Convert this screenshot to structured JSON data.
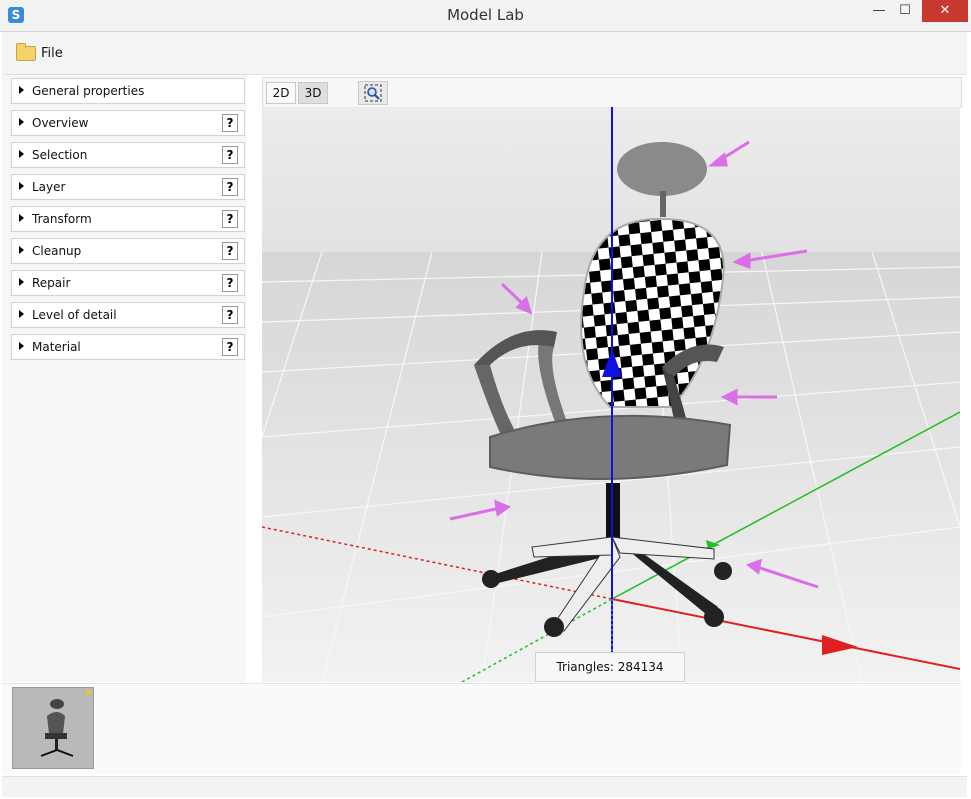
{
  "window": {
    "title": "Model Lab",
    "minimize": "—",
    "maximize": "☐",
    "close": "✕"
  },
  "menu": {
    "file_label": "File"
  },
  "panels": [
    {
      "label": "General properties",
      "help": false
    },
    {
      "label": "Overview",
      "help": true
    },
    {
      "label": "Selection",
      "help": true
    },
    {
      "label": "Layer",
      "help": true
    },
    {
      "label": "Transform",
      "help": true
    },
    {
      "label": "Cleanup",
      "help": true
    },
    {
      "label": "Repair",
      "help": true
    },
    {
      "label": "Level of detail",
      "help": true
    },
    {
      "label": "Material",
      "help": true
    }
  ],
  "help_glyph": "?",
  "toolbar": {
    "btn_2d": "2D",
    "btn_3d": "3D",
    "active_mode": "3D"
  },
  "viewport": {
    "triangles_label": "Triangles: 284134"
  },
  "colors": {
    "x_axis": "#e02020",
    "y_axis": "#20c020",
    "z_axis": "#1010e0",
    "arrow": "#d96ee6",
    "close": "#c7392e"
  },
  "icons": {
    "app": "app-icon",
    "folder": "folder-icon",
    "zoom": "zoom-fit-icon"
  }
}
